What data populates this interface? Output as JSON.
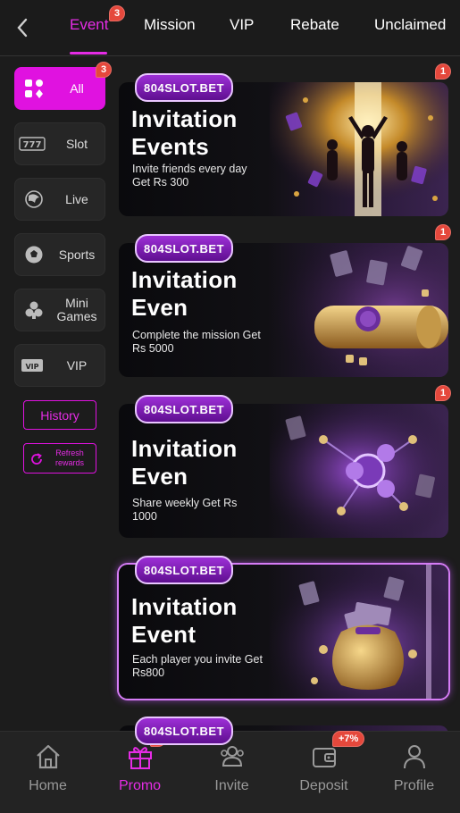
{
  "header": {
    "tabs": [
      {
        "label": "Event",
        "badge": "3",
        "active": true
      },
      {
        "label": "Mission"
      },
      {
        "label": "VIP"
      },
      {
        "label": "Rebate"
      },
      {
        "label": "Unclaimed"
      }
    ]
  },
  "sidebar": {
    "items": [
      {
        "label": "All",
        "badge": "3",
        "icon": "grid-icon",
        "active": true
      },
      {
        "label": "Slot",
        "icon": "slot-777-icon"
      },
      {
        "label": "Live",
        "icon": "live-dealer-icon"
      },
      {
        "label": "Sports",
        "icon": "soccer-ball-icon"
      },
      {
        "label": "Mini Games",
        "icon": "mini-games-icon"
      },
      {
        "label": "VIP",
        "icon": "vip-card-icon"
      }
    ],
    "history_label": "History",
    "refresh_label": "Refresh rewards"
  },
  "banners": [
    {
      "logo": "804SLOT.BET",
      "title_line1": "Invitation",
      "title_line2": "Events",
      "subtitle": "Invite friends every day Get Rs 300",
      "badge": "1"
    },
    {
      "logo": "804SLOT.BET",
      "title_line1": "Invitation",
      "title_line2": "Even",
      "subtitle": "Complete the mission Get Rs 5000",
      "badge": "1"
    },
    {
      "logo": "804SLOT.BET",
      "title_line1": "Invitation",
      "title_line2": "Even",
      "subtitle": "Share weekly Get Rs 1000",
      "badge": "1"
    },
    {
      "logo": "804SLOT.BET",
      "title_line1": "Invitation",
      "title_line2": "Event",
      "subtitle": "Each player you invite Get Rs800",
      "badge": ""
    },
    {
      "logo": "804SLOT.BET",
      "title_line1": "",
      "title_line2": "",
      "subtitle": "",
      "badge": ""
    }
  ],
  "bottom_nav": {
    "items": [
      {
        "label": "Home",
        "icon": "home-icon"
      },
      {
        "label": "Promo",
        "icon": "gift-icon",
        "badge": "3",
        "active": true
      },
      {
        "label": "Invite",
        "icon": "invite-icon"
      },
      {
        "label": "Deposit",
        "icon": "wallet-icon",
        "badge": "+7%"
      },
      {
        "label": "Profile",
        "icon": "profile-icon"
      }
    ]
  },
  "colors": {
    "accent": "#e012e0",
    "badge": "#e5483c",
    "background": "#1c1c1c"
  }
}
